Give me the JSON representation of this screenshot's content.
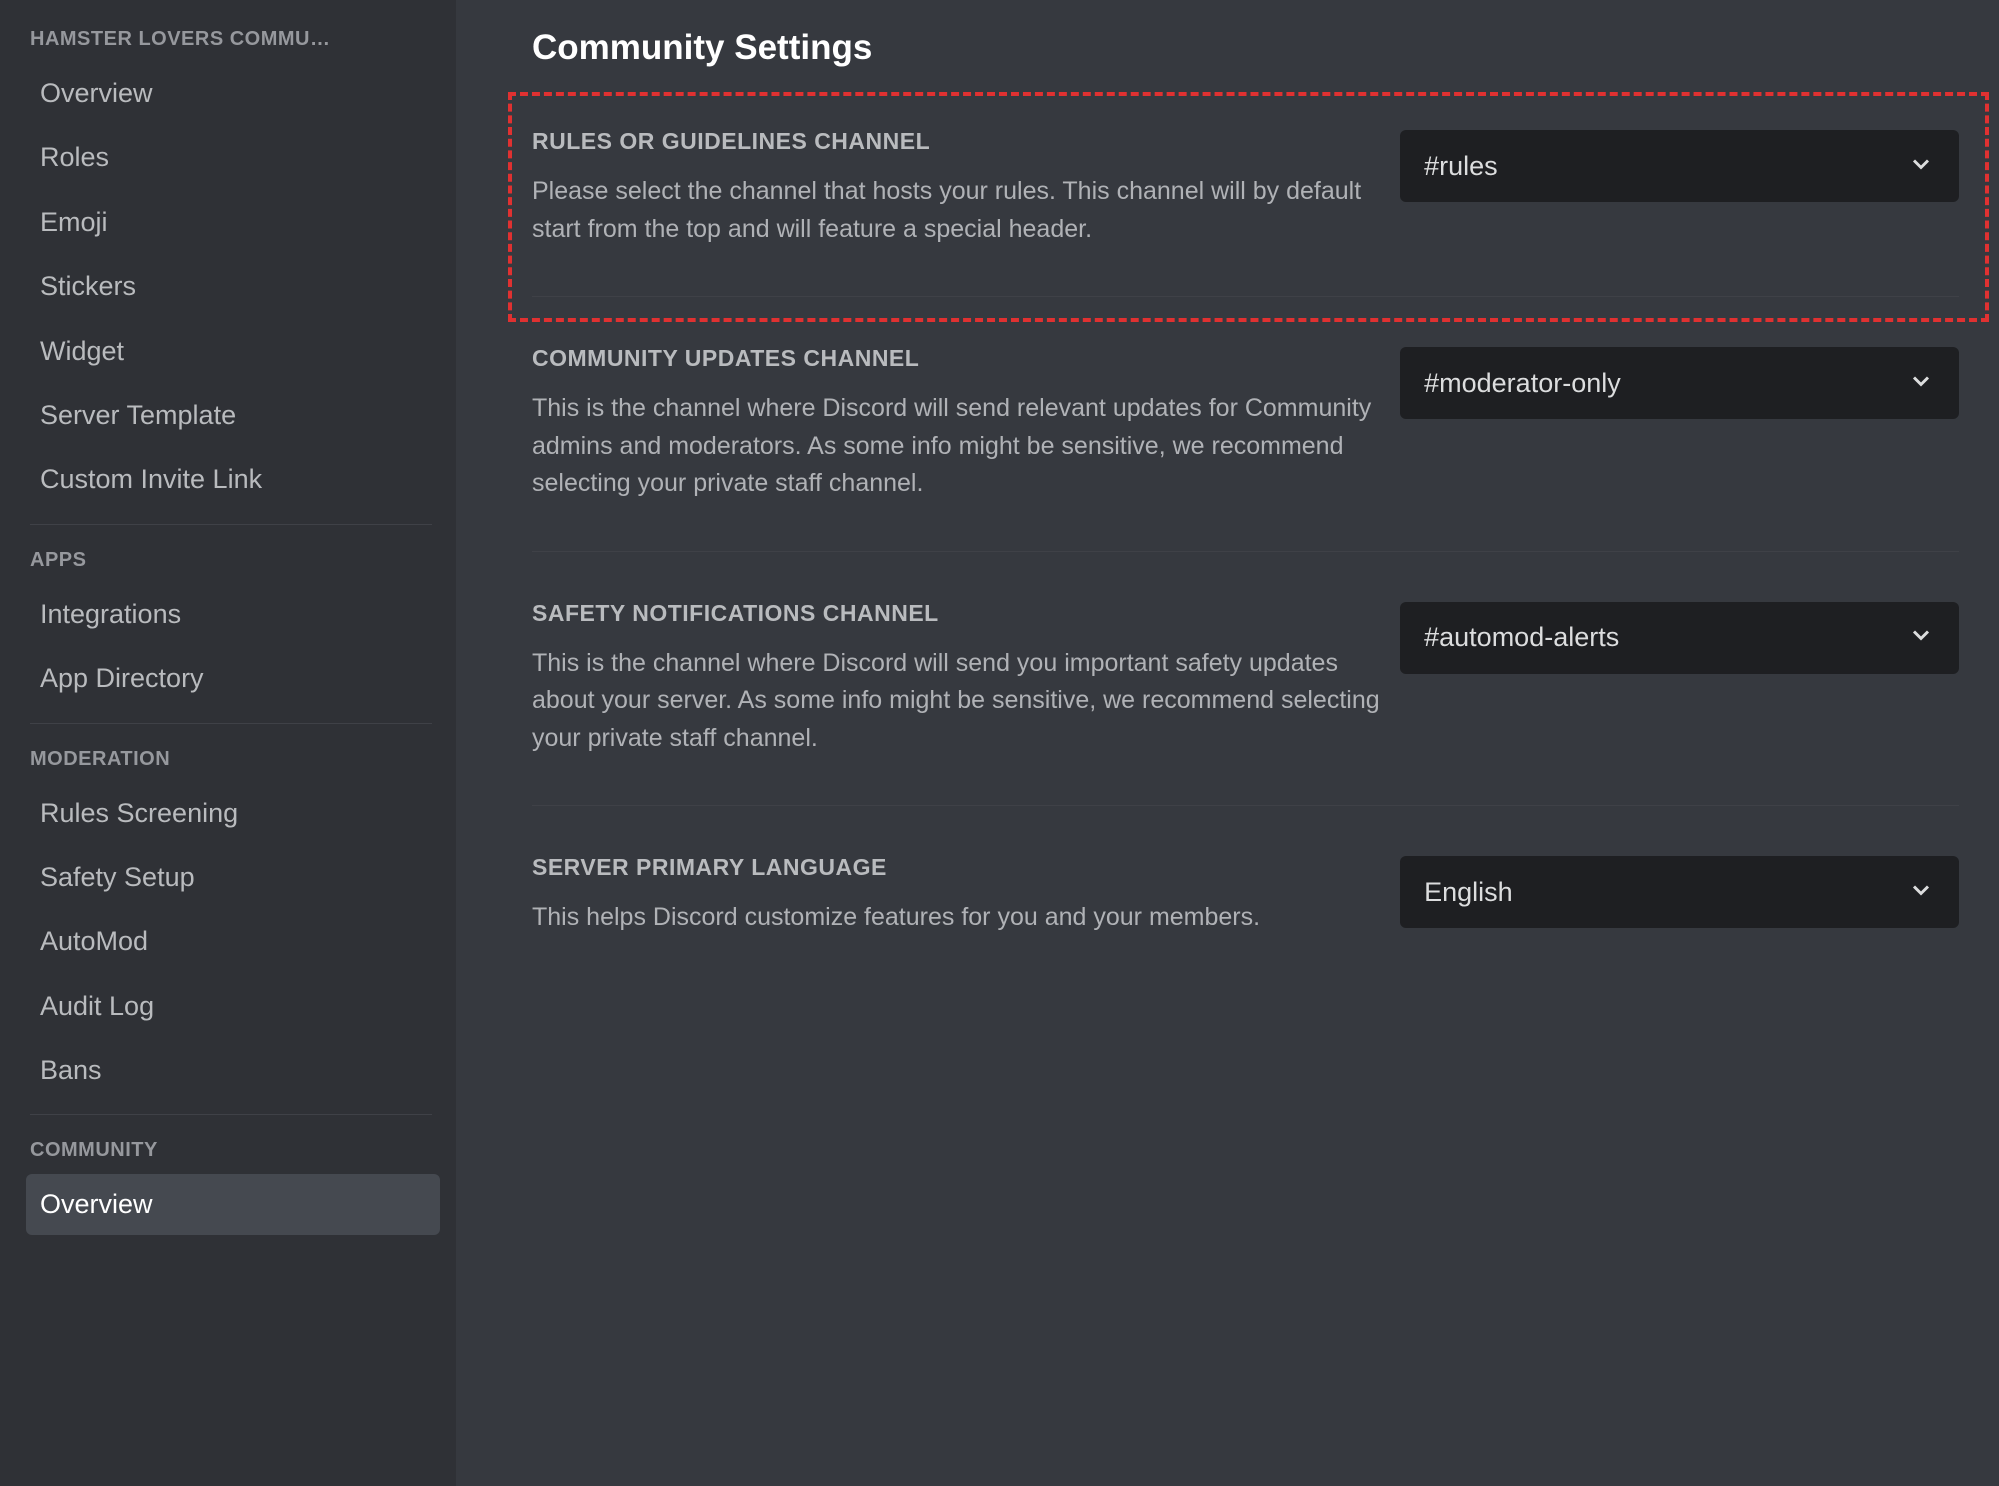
{
  "sidebar": {
    "server_header": "HAMSTER LOVERS COMMU…",
    "groups": [
      {
        "section": null,
        "items": [
          {
            "label": "Overview",
            "active": false
          },
          {
            "label": "Roles",
            "active": false
          },
          {
            "label": "Emoji",
            "active": false
          },
          {
            "label": "Stickers",
            "active": false
          },
          {
            "label": "Widget",
            "active": false
          },
          {
            "label": "Server Template",
            "active": false
          },
          {
            "label": "Custom Invite Link",
            "active": false
          }
        ]
      },
      {
        "section": "APPS",
        "items": [
          {
            "label": "Integrations",
            "active": false
          },
          {
            "label": "App Directory",
            "active": false
          }
        ]
      },
      {
        "section": "MODERATION",
        "items": [
          {
            "label": "Rules Screening",
            "active": false
          },
          {
            "label": "Safety Setup",
            "active": false
          },
          {
            "label": "AutoMod",
            "active": false
          },
          {
            "label": "Audit Log",
            "active": false
          },
          {
            "label": "Bans",
            "active": false
          }
        ]
      },
      {
        "section": "COMMUNITY",
        "items": [
          {
            "label": "Overview",
            "active": true
          }
        ]
      }
    ]
  },
  "main": {
    "title": "Community Settings",
    "settings": [
      {
        "title": "RULES OR GUIDELINES CHANNEL",
        "desc": "Please select the channel that hosts your rules. This channel will by default start from the top and will feature a special header.",
        "value": "#rules",
        "highlighted": true
      },
      {
        "title": "COMMUNITY UPDATES CHANNEL",
        "desc": "This is the channel where Discord will send relevant updates for Community admins and moderators. As some info might be sensitive, we recommend selecting your private staff channel.",
        "value": "#moderator-only",
        "highlighted": false
      },
      {
        "title": "SAFETY NOTIFICATIONS CHANNEL",
        "desc": "This is the channel where Discord will send you important safety updates about your server. As some info might be sensitive, we recommend selecting your private staff channel.",
        "value": "#automod-alerts",
        "highlighted": false
      },
      {
        "title": "SERVER PRIMARY LANGUAGE",
        "desc": "This helps Discord customize features for you and your members.",
        "value": "English",
        "highlighted": false
      }
    ]
  }
}
